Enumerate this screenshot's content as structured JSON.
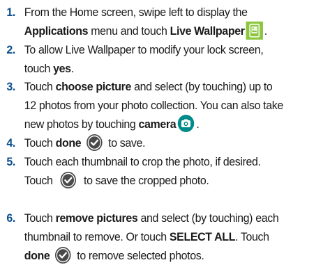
{
  "steps": [
    {
      "number": "1.",
      "line1_text": "From the Home screen, swipe left to display the",
      "line2_bold1": "Applications",
      "line2_text1": " menu and touch ",
      "line2_bold2": "Live Wallpaper",
      "line2_end": ".",
      "icon": "live-wallpaper-app-icon"
    },
    {
      "number": "2.",
      "line1_text": "To allow Live Wallpaper to modify your lock screen,",
      "line2_text1": "touch ",
      "line2_bold1": "yes",
      "line2_end": "."
    },
    {
      "number": "3.",
      "line1_text1": "Touch ",
      "line1_bold1": "choose picture",
      "line1_text2": " and select (by touching) up to",
      "line2_text": "12 photos from your photo collection. You can also take",
      "line3_text1": "new photos by touching ",
      "line3_bold1": "camera",
      "line3_end": ".",
      "icon": "camera-icon"
    },
    {
      "number": "4.",
      "line1_text1": "Touch ",
      "line1_bold1": "done",
      "line1_text2": " to save.",
      "icon": "check-circle-icon"
    },
    {
      "number": "5.",
      "line1_text": "Touch each thumbnail to crop the photo, if desired.",
      "line2_text1": "Touch",
      "line2_text2": " to save the cropped photo.",
      "icon": "check-circle-icon"
    },
    {
      "number": "6.",
      "line1_text1": "Touch ",
      "line1_bold1": "remove pictures",
      "line1_text2": " and select (by touching) each",
      "line2_text1": "thumbnail to remove. Or touch ",
      "line2_bold1": "SELECT ALL",
      "line2_end": ". Touch",
      "line3_bold1": "done",
      "line3_text2": " to remove selected photos.",
      "icon": "check-circle-icon"
    }
  ],
  "colors": {
    "step_number": "#0a4d8c",
    "text": "#1a1a1a",
    "wallpaper_icon": "#8cc63f",
    "camera_icon_circle": "#008a8a",
    "check_icon_circle": "#4a4a4a"
  }
}
